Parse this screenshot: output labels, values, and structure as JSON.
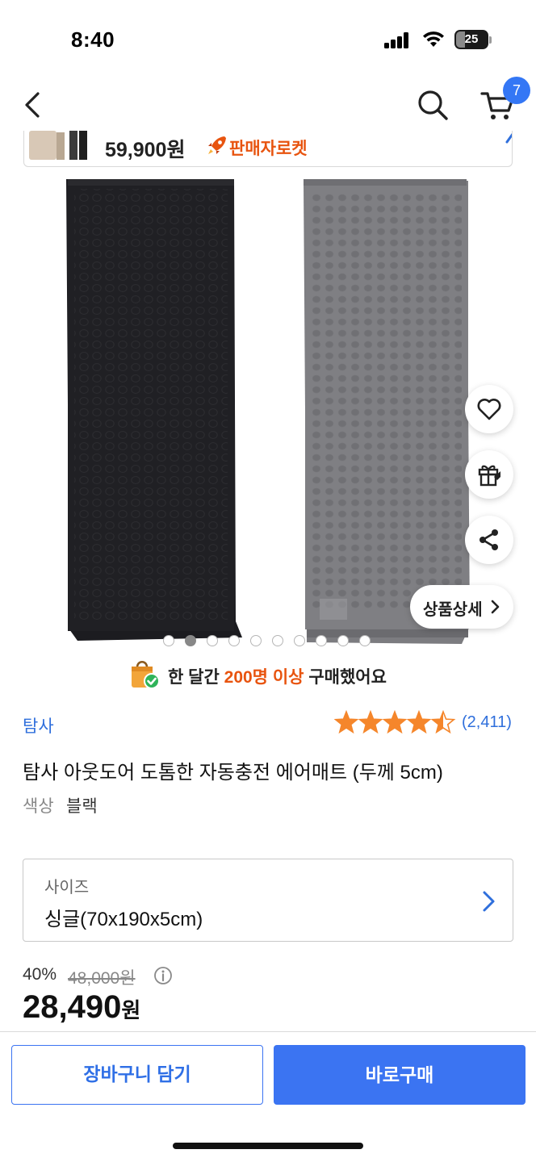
{
  "status_bar": {
    "time": "8:40",
    "battery": "25"
  },
  "nav": {
    "cart_count": "7"
  },
  "sticky": {
    "price": "59,900원",
    "badge": "판매자로켓"
  },
  "gallery": {
    "total_images": 10,
    "active_index": 1
  },
  "side_actions": {
    "detail_label": "상품상세"
  },
  "purchase_notice": {
    "prefix": "한 달간 ",
    "highlight": "200명 이상",
    "suffix": " 구매했어요"
  },
  "product": {
    "brand": "탐사",
    "rating": 4.5,
    "review_count": "(2,411)",
    "title": "탐사 아웃도어 도톰한 자동충전 에어매트 (두께 5cm)",
    "color_label": "색상",
    "color_value": "블랙"
  },
  "size_option": {
    "label": "사이즈",
    "value": "싱글(70x190x5cm)"
  },
  "pricing": {
    "discount": "40%",
    "original": "48,000원",
    "sale": "28,490",
    "unit": "원"
  },
  "actions": {
    "add_to_cart": "장바구니 담기",
    "buy_now": "바로구매"
  },
  "colors": {
    "accent": "#3b74f2",
    "highlight": "#e8540f",
    "star": "#f5862b"
  }
}
